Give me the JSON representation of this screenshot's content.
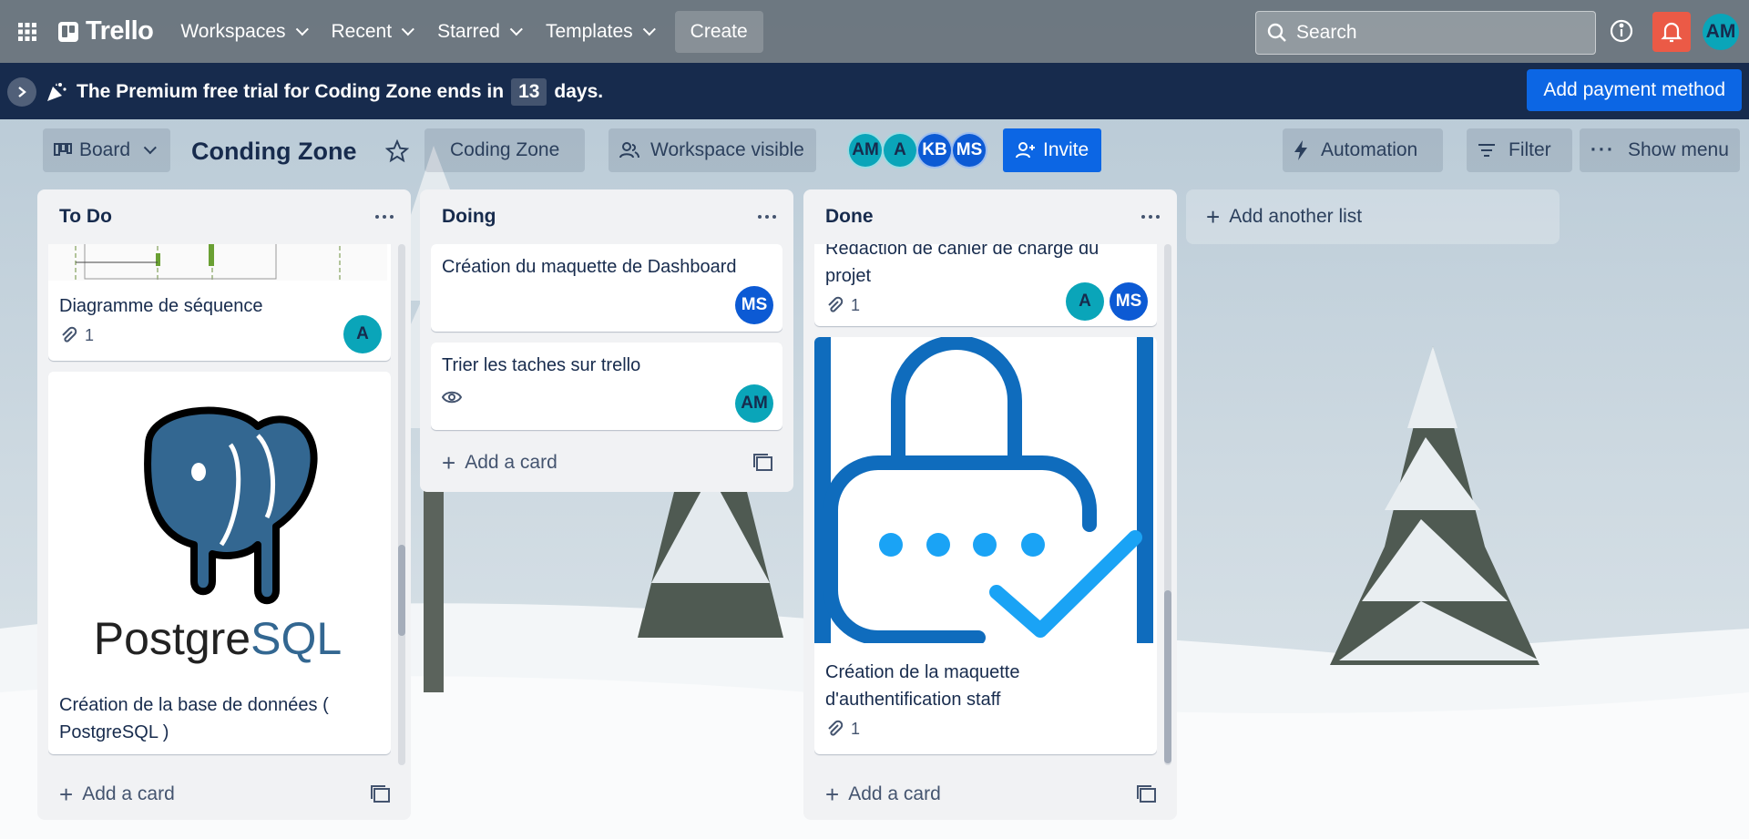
{
  "header": {
    "logo": "Trello",
    "nav": [
      {
        "label": "Workspaces"
      },
      {
        "label": "Recent"
      },
      {
        "label": "Starred"
      },
      {
        "label": "Templates"
      }
    ],
    "create_label": "Create",
    "search_placeholder": "Search",
    "user_initials": "AM",
    "colors": {
      "bar": "#677179",
      "notification": "#eb5a46"
    }
  },
  "banner": {
    "message_start": "The Premium free trial for Coding Zone ends in",
    "days": "13",
    "message_end": "days.",
    "pay_label": "Add payment method"
  },
  "board": {
    "view_label": "Board",
    "title": "Conding Zone",
    "workspace": "Coding Zone",
    "visibility": "Workspace visible",
    "members": [
      "AM",
      "A",
      "KB",
      "MS"
    ],
    "invite_label": "Invite",
    "automation_label": "Automation",
    "filter_label": "Filter",
    "show_menu_label": "Show menu",
    "add_list_label": "Add another list"
  },
  "lists": [
    {
      "title": "To Do",
      "cards": [
        {
          "title": "Diagramme de séquence",
          "attachments": "1",
          "members": [
            "A"
          ]
        },
        {
          "title": "Création de la base de données ( PostgreSQL )",
          "cover": "postgresql-logo",
          "cover_text": "PostgreSQL"
        }
      ],
      "add_card_label": "Add a card"
    },
    {
      "title": "Doing",
      "cards": [
        {
          "title": "Création du maquette de Dashboard",
          "members": [
            "MS"
          ]
        },
        {
          "title": "Trier les taches sur trello",
          "watching": true,
          "members": [
            "AM"
          ]
        }
      ],
      "add_card_label": "Add a card"
    },
    {
      "title": "Done",
      "cards": [
        {
          "title": "Rédaction de cahier de charge du projet",
          "attachments": "1",
          "members": [
            "A",
            "MS"
          ]
        },
        {
          "title": "Création de la maquette d'authentification staff",
          "attachments": "1",
          "cover": "lock-password-icon"
        }
      ],
      "add_card_label": "Add a card"
    }
  ]
}
